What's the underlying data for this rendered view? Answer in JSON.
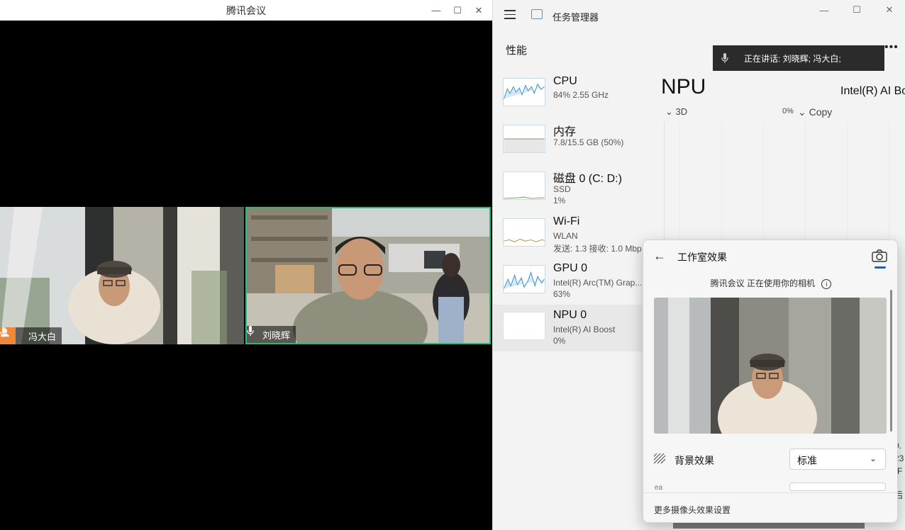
{
  "meeting": {
    "title": "腾讯会议",
    "participants": [
      {
        "name": "冯大白",
        "is_host": true,
        "muted": false
      },
      {
        "name": "刘晓辉",
        "is_host": false,
        "muted": false,
        "active_speaker": true
      }
    ]
  },
  "taskmgr": {
    "title": "任务管理器",
    "section": "性能",
    "resources": [
      {
        "name": "CPU",
        "line1": "84%  2.55 GHz",
        "line2": ""
      },
      {
        "name": "内存",
        "line1": "7.8/15.5 GB (50%)",
        "line2": ""
      },
      {
        "name": "磁盘 0 (C: D:)",
        "line1": "SSD",
        "line2": "1%"
      },
      {
        "name": "Wi-Fi",
        "line1": "WLAN",
        "line2": "发送: 1.3  接收: 1.0 Mbp"
      },
      {
        "name": "GPU 0",
        "line1": "Intel(R) Arc(TM) Grap...",
        "line2": "63%"
      },
      {
        "name": "NPU 0",
        "line1": "Intel(R) AI Boost",
        "line2": "0%"
      }
    ],
    "detail": {
      "title": "NPU",
      "model": "Intel(R) AI Bo",
      "engine_left": "3D",
      "engine_pct": "0%",
      "engine_right": "Copy"
    },
    "side_values": [
      "0.",
      "23",
      "(F",
      "I 后"
    ]
  },
  "toast": {
    "text": "正在讲话:   刘晓辉; 冯大白;"
  },
  "flyout": {
    "title": "工作室效果",
    "info": "腾讯会议 正在使用你的相机",
    "background_label": "背景效果",
    "background_value": "标准",
    "next_label": "ea",
    "footer_link": "更多摄像头效果设置"
  },
  "colors": {
    "active_speaker_border": "#1fbf7a",
    "host_badge": "#f0883a",
    "accent": "#2a5ea8"
  }
}
